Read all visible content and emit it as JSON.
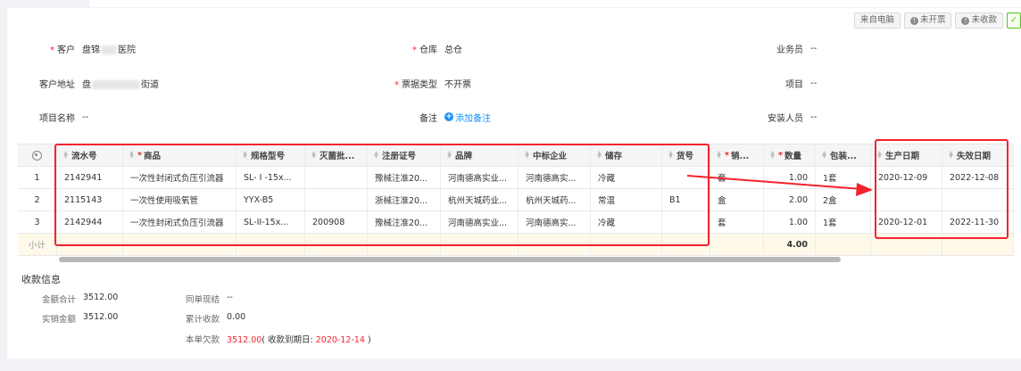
{
  "status_tags": {
    "source": "来自电脑",
    "invoice": "未开票",
    "collect": "未收款",
    "check_icon": "✓"
  },
  "form": {
    "customer_label": "客户",
    "customer_value": "盘锦",
    "customer_value_tail": "医院",
    "warehouse_label": "仓库",
    "warehouse_value": "总仓",
    "salesman_label": "业务员",
    "salesman_value": "--",
    "address_label": "客户地址",
    "address_value_head": "盘",
    "address_value_tail": "街道",
    "bill_type_label": "票据类型",
    "bill_type_value": "不开票",
    "project_label": "项目",
    "project_value": "--",
    "project_name_label": "项目名称",
    "project_name_value": "--",
    "remark_label": "备注",
    "add_remark": "添加备注",
    "installer_label": "安装人员",
    "installer_value": "--"
  },
  "table": {
    "headers": {
      "serial": "流水号",
      "product": "商品",
      "spec": "规格型号",
      "batch": "灭菌批...",
      "reg": "注册证号",
      "brand": "品牌",
      "bid": "中标企业",
      "storage": "储存",
      "slot": "货号",
      "sales_unit": "销...",
      "qty": "数量",
      "pack": "包装...",
      "prod_date": "生产日期",
      "exp_date": "失效日期"
    },
    "rows": [
      {
        "idx": "1",
        "serial": "2142941",
        "product": "一次性封闭式负压引流器",
        "spec": "SL- I -15x...",
        "batch": "",
        "reg": "豫械注准20...",
        "brand": "河南德高实业...",
        "bid": "河南德高实...",
        "storage": "冷藏",
        "slot": "",
        "unit": "套",
        "qty": "1.00",
        "pack": "1套",
        "prod_date": "2020-12-09",
        "exp_date": "2022-12-08"
      },
      {
        "idx": "2",
        "serial": "2115143",
        "product": "一次性使用吸氧管",
        "spec": "YYX-B5",
        "batch": "",
        "reg": "浙械注准20...",
        "brand": "杭州天城药业...",
        "bid": "杭州天城药...",
        "storage": "常温",
        "slot": "B1",
        "unit": "盒",
        "qty": "2.00",
        "pack": "2盒",
        "prod_date": "",
        "exp_date": ""
      },
      {
        "idx": "3",
        "serial": "2142944",
        "product": "一次性封闭式负压引流器",
        "spec": "SL-II-15x...",
        "batch": "200908",
        "reg": "豫械注准20...",
        "brand": "河南德高实业...",
        "bid": "河南德高实...",
        "storage": "冷藏",
        "slot": "",
        "unit": "套",
        "qty": "1.00",
        "pack": "1套",
        "prod_date": "2020-12-01",
        "exp_date": "2022-11-30"
      }
    ],
    "subtotal_label": "小计",
    "subtotal_qty": "4.00"
  },
  "payment": {
    "title": "收款信息",
    "total_label": "金额合计",
    "total_value": "3512.00",
    "actual_label": "实销金额",
    "actual_value": "3512.00",
    "cashier_label": "同单现结",
    "cashier_value": "--",
    "received_label": "累计收款",
    "received_value": "0.00",
    "debt_label": "本单欠款",
    "debt_value": "3512.00",
    "due_prefix": "( 收款到期日: ",
    "due_date": "2020-12-14",
    "due_suffix": " )"
  },
  "colors": {
    "accent": "#1890ff",
    "required": "#f5222d",
    "highlight_box": "#f5222d",
    "subtotal_bg": "#fff9ea"
  }
}
